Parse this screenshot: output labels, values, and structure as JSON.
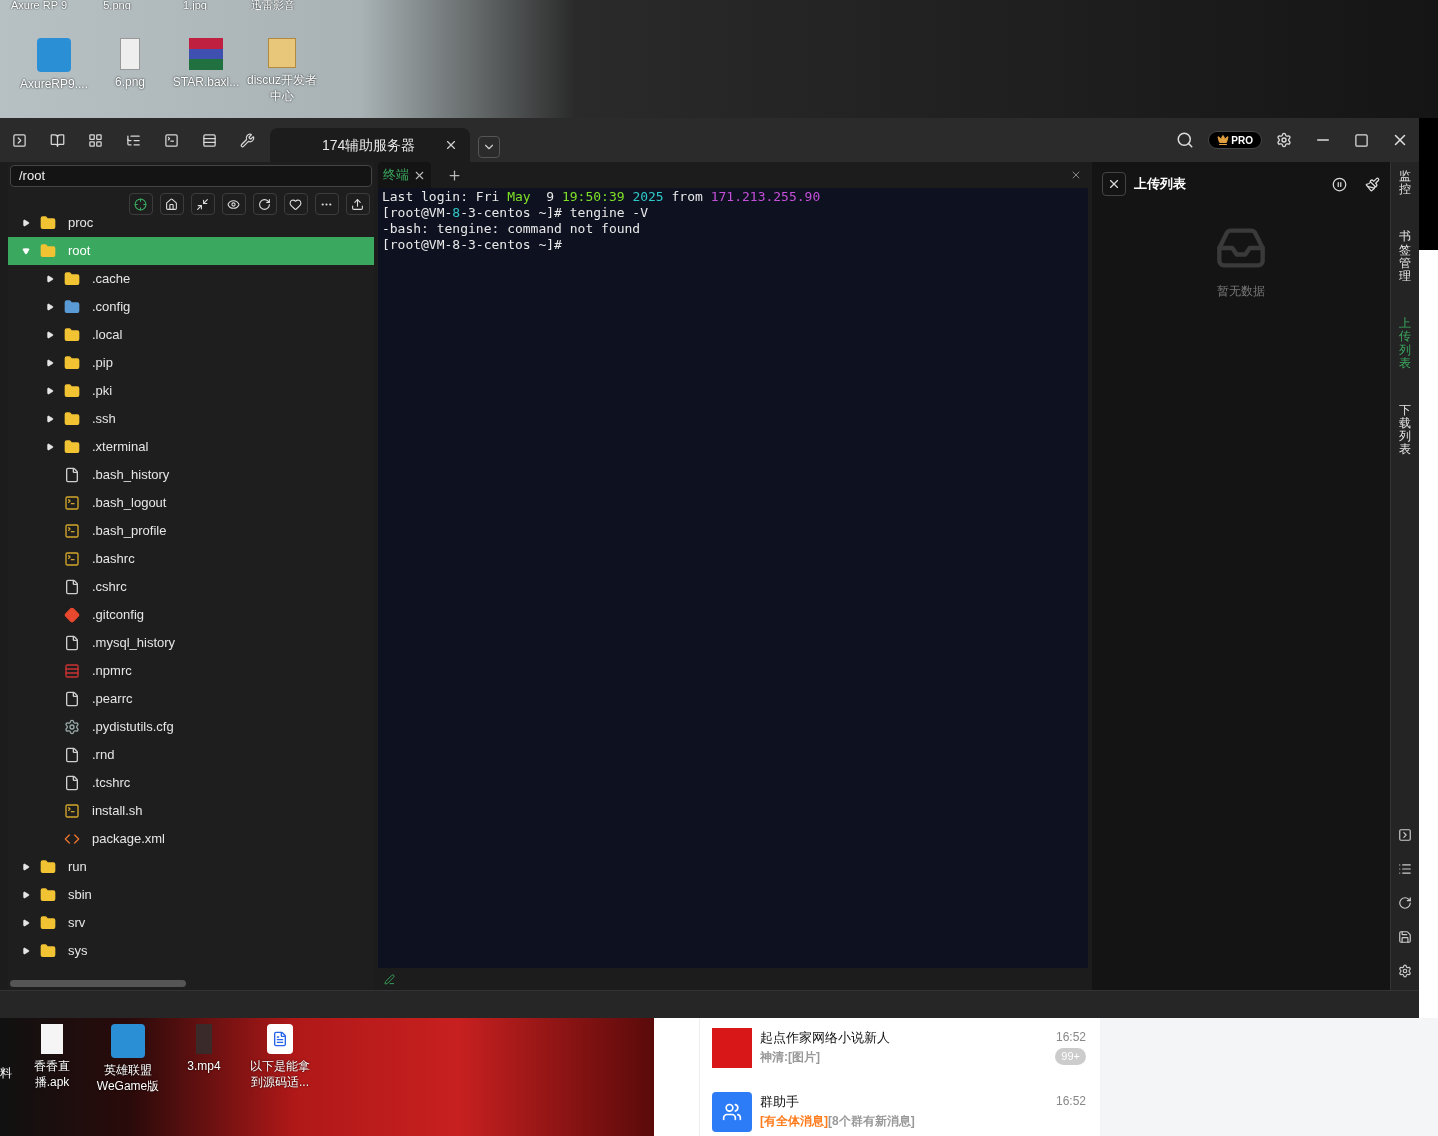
{
  "desktop_top": {
    "partial_labels": [
      "Axure RP 9",
      "5.png",
      "1.jpg",
      "迅雷影音"
    ],
    "icons": [
      {
        "label": "AxureRP9....",
        "kind": "app"
      },
      {
        "label": "6.png",
        "kind": "image"
      },
      {
        "label": "STAR.baxl...",
        "kind": "archive"
      },
      {
        "label": "discuz开发者中心",
        "kind": "folder"
      }
    ]
  },
  "window": {
    "tab_title": "174辅助服务器",
    "pro_badge": "PRO"
  },
  "file_panel": {
    "path": "/root",
    "tree": [
      {
        "name": "proc",
        "kind": "folder",
        "expanded": false,
        "selected": false
      },
      {
        "name": "root",
        "kind": "folder",
        "expanded": true,
        "selected": true,
        "children": [
          {
            "name": ".cache",
            "kind": "folder",
            "expanded": false,
            "selected": false
          },
          {
            "name": ".config",
            "kind": "config-folder",
            "expanded": false,
            "selected": false
          },
          {
            "name": ".local",
            "kind": "folder",
            "expanded": false,
            "selected": false
          },
          {
            "name": ".pip",
            "kind": "folder",
            "expanded": false,
            "selected": false
          },
          {
            "name": ".pki",
            "kind": "folder",
            "expanded": false,
            "selected": false
          },
          {
            "name": ".ssh",
            "kind": "folder",
            "expanded": false,
            "selected": false
          },
          {
            "name": ".xterminal",
            "kind": "folder",
            "expanded": false,
            "selected": false
          },
          {
            "name": ".bash_history",
            "kind": "file",
            "selected": false
          },
          {
            "name": ".bash_logout",
            "kind": "script",
            "selected": false
          },
          {
            "name": ".bash_profile",
            "kind": "script",
            "selected": false
          },
          {
            "name": ".bashrc",
            "kind": "script",
            "selected": false
          },
          {
            "name": ".cshrc",
            "kind": "file",
            "selected": false
          },
          {
            "name": ".gitconfig",
            "kind": "git",
            "selected": false
          },
          {
            "name": ".mysql_history",
            "kind": "file",
            "selected": false
          },
          {
            "name": ".npmrc",
            "kind": "npm",
            "selected": false
          },
          {
            "name": ".pearrc",
            "kind": "file",
            "selected": false
          },
          {
            "name": ".pydistutils.cfg",
            "kind": "gear",
            "selected": false
          },
          {
            "name": ".rnd",
            "kind": "file",
            "selected": false
          },
          {
            "name": ".tcshrc",
            "kind": "file",
            "selected": false
          },
          {
            "name": "install.sh",
            "kind": "script",
            "selected": false
          },
          {
            "name": "package.xml",
            "kind": "xml",
            "selected": false
          }
        ]
      },
      {
        "name": "run",
        "kind": "folder",
        "expanded": false,
        "selected": false
      },
      {
        "name": "sbin",
        "kind": "folder",
        "expanded": false,
        "selected": false
      },
      {
        "name": "srv",
        "kind": "folder",
        "expanded": false,
        "selected": false
      },
      {
        "name": "sys",
        "kind": "folder",
        "expanded": false,
        "selected": false
      }
    ]
  },
  "terminal": {
    "tab": "终端",
    "lines": [
      [
        {
          "text": "Last login: Fri ",
          "color": "#e8e8e8"
        },
        {
          "text": "May",
          "color": "#7ee027"
        },
        {
          "text": "  9 ",
          "color": "#e8e8e8"
        },
        {
          "text": "19:50:39 ",
          "color": "#7ee027"
        },
        {
          "text": "2025",
          "color": "#2fc9c9"
        },
        {
          "text": " from ",
          "color": "#e8e8e8"
        },
        {
          "text": "171.213.255.90",
          "color": "#c44fd8"
        }
      ],
      [
        {
          "text": "[root@VM-",
          "color": "#e8e8e8"
        },
        {
          "text": "8",
          "color": "#2fc9c9"
        },
        {
          "text": "-3-centos ~]# tengine -V",
          "color": "#e8e8e8"
        }
      ],
      [
        {
          "text": "-bash: tengine: command not found",
          "color": "#e8e8e8"
        }
      ],
      [
        {
          "text": "[root@VM-8-3-centos ~]#",
          "color": "#e8e8e8"
        }
      ]
    ]
  },
  "upload_panel": {
    "title": "上传列表",
    "empty_text": "暂无数据"
  },
  "rail": [
    {
      "label": "监控",
      "selected": false
    },
    {
      "label": "书签管理",
      "selected": false
    },
    {
      "label": "上传列表",
      "selected": true
    },
    {
      "label": "下载列表",
      "selected": false
    }
  ],
  "desktop_bottom": {
    "partial_label": "料",
    "icons": [
      {
        "label": "香香直播.apk",
        "kind": "file"
      },
      {
        "label": "英雄联盟WeGame版",
        "kind": "app"
      },
      {
        "label": "3.mp4",
        "kind": "video"
      },
      {
        "label": "以下是能拿到源码适...",
        "kind": "doc"
      }
    ]
  },
  "chat": [
    {
      "name": "起点作家网络小说新人",
      "time": "16:52",
      "badge": "99+",
      "kind": "seal",
      "preview": [
        {
          "text": "神清:[图片]",
          "color": "#999999"
        }
      ]
    },
    {
      "name": "群助手",
      "time": "16:52",
      "kind": "group",
      "preview": [
        {
          "text": "[有全体消息]",
          "color": "#ff7a1a"
        },
        {
          "text": "[8个群有新消息]",
          "color": "#999999"
        }
      ]
    }
  ]
}
